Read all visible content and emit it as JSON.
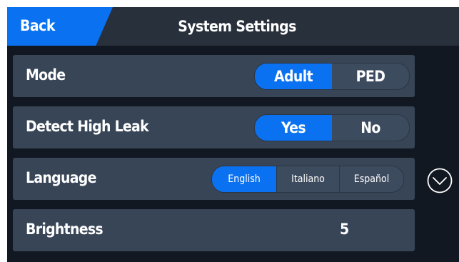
{
  "header": {
    "back_label": "Back",
    "title": "System Settings"
  },
  "settings": {
    "mode": {
      "label": "Mode",
      "options": [
        "Adult",
        "PED"
      ],
      "selected": "Adult"
    },
    "detect_high_leak": {
      "label": "Detect High Leak",
      "options": [
        "Yes",
        "No"
      ],
      "selected": "Yes"
    },
    "language": {
      "label": "Language",
      "options": [
        "English",
        "Italiano",
        "Español"
      ],
      "selected": "English"
    },
    "brightness": {
      "label": "Brightness",
      "value": "5"
    }
  },
  "icons": {
    "scroll_down": "chevron-down-circle-icon"
  },
  "colors": {
    "accent": "#0a72f0",
    "background": "#121821",
    "header": "#28303c",
    "row": "#374557"
  }
}
